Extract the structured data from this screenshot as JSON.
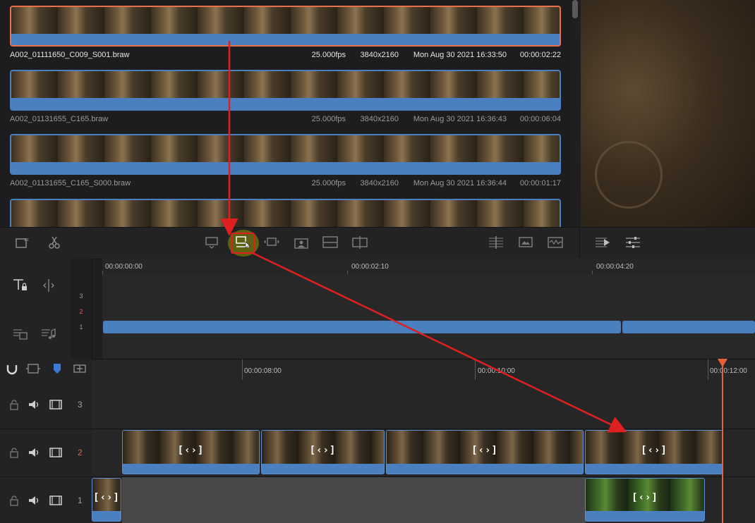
{
  "media_pool": {
    "clips": [
      {
        "name": "A002_01111650_C009_S001.braw",
        "fps": "25.000fps",
        "resolution": "3840x2160",
        "date": "Mon Aug 30 2021 16:33:50",
        "duration": "00:00:02:22",
        "selected": true
      },
      {
        "name": "A002_01131655_C165.braw",
        "fps": "25.000fps",
        "resolution": "3840x2160",
        "date": "Mon Aug 30 2021 16:36:43",
        "duration": "00:00:06:04",
        "selected": false
      },
      {
        "name": "A002_01131655_C165_S000.braw",
        "fps": "25.000fps",
        "resolution": "3840x2160",
        "date": "Mon Aug 30 2021 16:36:44",
        "duration": "00:00:01:17",
        "selected": false
      }
    ]
  },
  "upper_timeline": {
    "ruler_labels": [
      "00:00:00:00",
      "00:00:02:10",
      "00:00:04:20"
    ],
    "track_numbers": [
      "3",
      "2",
      "1"
    ]
  },
  "lower_timeline": {
    "ruler_labels": [
      "00:00:08:00",
      "00:00:10:00",
      "00:00:12:00"
    ],
    "tracks": [
      {
        "number": "3"
      },
      {
        "number": "2"
      },
      {
        "number": "1"
      }
    ],
    "clip_effect_glyph": "[‹›]"
  },
  "colors": {
    "clip_blue": "#4a80bf",
    "selection_orange": "#e8704a",
    "playhead": "#e8603a",
    "annotation_red": "#e02020",
    "highlight_yellow": "#6b6b10"
  },
  "toolbar_icons": [
    "source-tape-icon",
    "razor-icon",
    "smart-insert-icon",
    "append-icon",
    "ripple-overwrite-icon",
    "close-up-icon",
    "place-on-top-icon",
    "source-overwrite-icon",
    "match-frame-icon",
    "viewer-mode-icon",
    "audio-waveform-icon",
    "render-icon",
    "settings-sliders-icon"
  ]
}
